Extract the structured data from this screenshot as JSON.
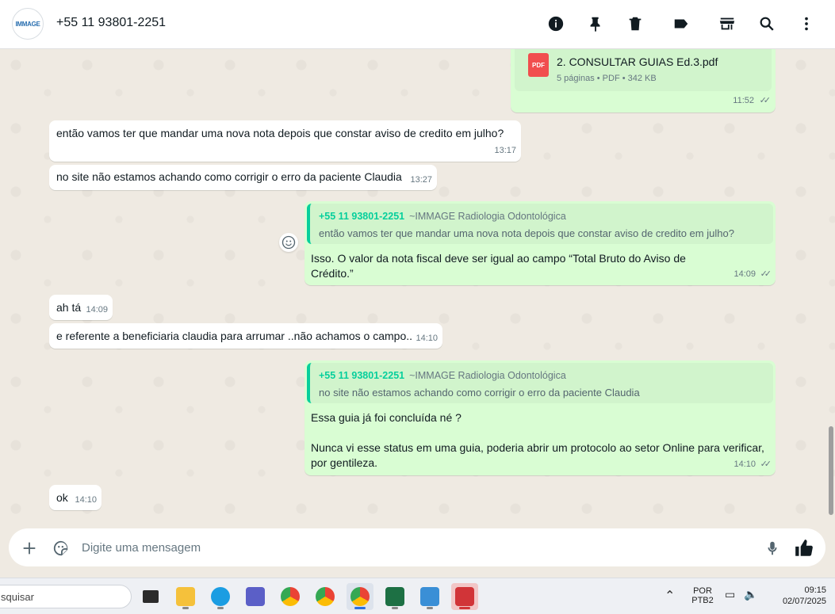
{
  "header": {
    "avatar_text": "IMMAGE",
    "contact": "+55 11 93801-2251"
  },
  "messages": {
    "pdf": {
      "icon_label": "PDF",
      "name": "2. CONSULTAR GUIAS Ed.3.pdf",
      "meta": "5 páginas • PDF • 342 KB",
      "time": "11:52"
    },
    "m1": {
      "text": "então vamos ter que mandar uma nova nota depois que constar aviso de credito em julho?",
      "time": "13:17"
    },
    "m2": {
      "text": "no site não estamos achando como corrigir o erro da paciente Claudia",
      "time": "13:27"
    },
    "m3": {
      "quote_name": "+55 11 93801-2251",
      "quote_sub": "~IMMAGE Radiologia Odontológica",
      "quote_text": "então vamos ter que mandar uma nova nota depois que constar aviso de credito em julho?",
      "line1": "Isso. O valor da nota fiscal deve ser igual ao campo “Total Bruto do Aviso de",
      "line2": "Crédito.”",
      "time": "14:09"
    },
    "m4": {
      "text": "ah tá",
      "time": "14:09"
    },
    "m5": {
      "text": "e referente a beneficiaria claudia para arrumar ..não achamos o campo..",
      "time": "14:10"
    },
    "m6": {
      "quote_name": "+55 11 93801-2251",
      "quote_sub": "~IMMAGE Radiologia Odontológica",
      "quote_text": "no site não estamos achando como corrigir o erro da paciente Claudia",
      "line1": "Essa guia já foi concluída né ?",
      "line2": "Nunca vi esse status em uma guia, poderia abrir um protocolo ao setor Online para verificar,",
      "line3": "por gentileza.",
      "time": "14:10"
    },
    "m7": {
      "text": "ok",
      "time": "14:10"
    }
  },
  "composer": {
    "placeholder": "Digite uma mensagem"
  },
  "taskbar": {
    "search_text": "squisar",
    "lang_line1": "POR",
    "lang_line2": "PTB2",
    "clock_time": "09:15",
    "clock_date": "02/07/2025"
  }
}
